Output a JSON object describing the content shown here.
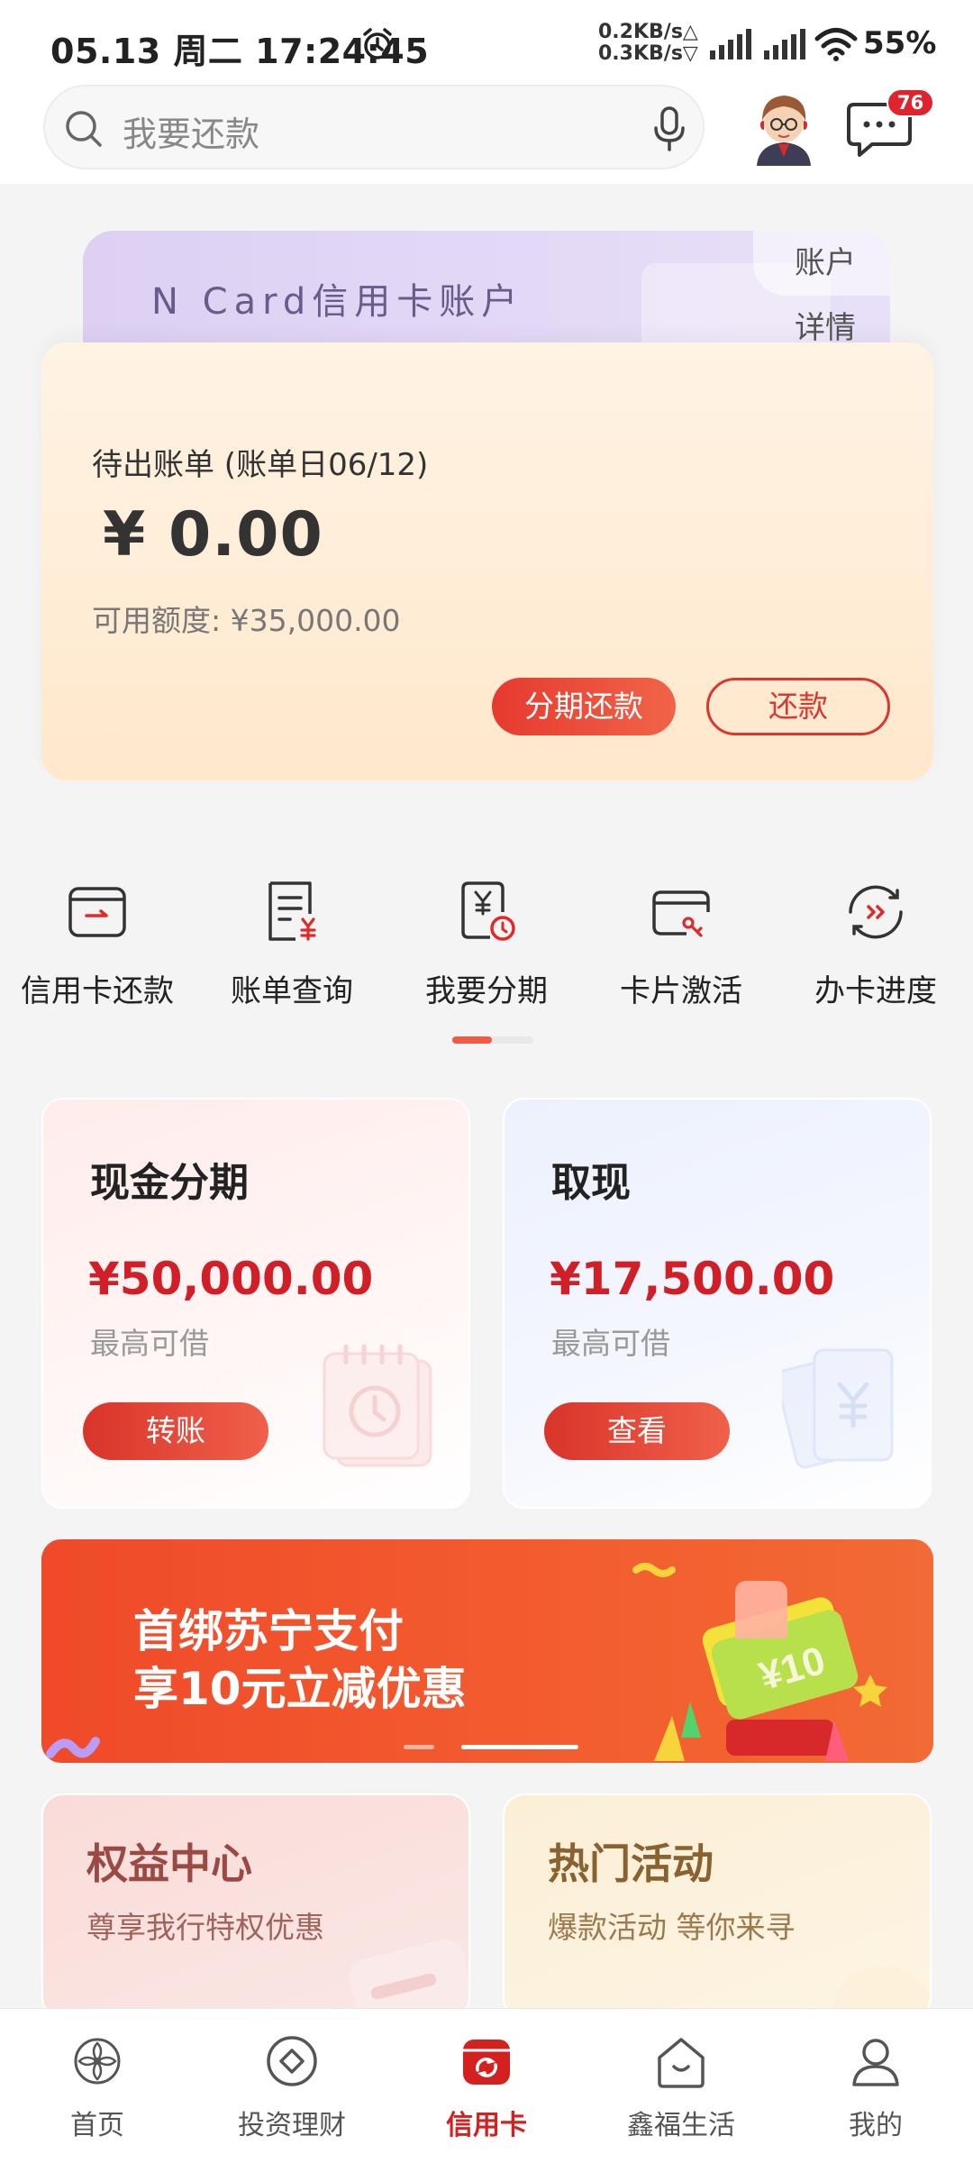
{
  "status_bar": {
    "time": "05.13 周二 17:24:45",
    "net_up": "0.2KB/s△",
    "net_down": "0.3KB/s▽",
    "battery": "55%",
    "icons": [
      "alarm-icon",
      "signal-icon",
      "signal-icon",
      "wifi-icon"
    ]
  },
  "header": {
    "search_placeholder": "我要还款",
    "message_badge": "76",
    "icons": [
      "search-icon",
      "mic-icon",
      "avatar",
      "message-icon"
    ]
  },
  "card_account": {
    "title": "N Card信用卡账户",
    "detail_link": "账户详情",
    "bill_label": "待出账单 (账单日06/12)",
    "bill_amount": "¥ 0.00",
    "available_credit": "可用额度: ¥35,000.00",
    "installment_button": "分期还款",
    "repay_button": "还款"
  },
  "quick_menu": [
    {
      "label": "信用卡还款",
      "icon": "card-repay-icon"
    },
    {
      "label": "账单查询",
      "icon": "bill-query-icon"
    },
    {
      "label": "我要分期",
      "icon": "installment-icon"
    },
    {
      "label": "卡片激活",
      "icon": "card-activate-icon"
    },
    {
      "label": "办卡进度",
      "icon": "card-progress-icon"
    }
  ],
  "loans": [
    {
      "title": "现金分期",
      "amount": "¥50,000.00",
      "sub": "最高可借",
      "button": "转账"
    },
    {
      "title": "取现",
      "amount": "¥17,500.00",
      "sub": "最高可借",
      "button": "查看"
    }
  ],
  "banner": {
    "line1": "首绑苏宁支付",
    "line2": "享10元立减优惠",
    "coupon_text": "¥10"
  },
  "promos": [
    {
      "title": "权益中心",
      "sub": "尊享我行特权优惠"
    },
    {
      "title": "热门活动",
      "sub": "爆款活动 等你来寻"
    }
  ],
  "tabbar": [
    {
      "label": "首页",
      "icon": "home-icon",
      "active": false
    },
    {
      "label": "投资理财",
      "icon": "invest-icon",
      "active": false
    },
    {
      "label": "信用卡",
      "icon": "credit-card-icon",
      "active": true
    },
    {
      "label": "鑫福生活",
      "icon": "life-icon",
      "active": false
    },
    {
      "label": "我的",
      "icon": "profile-icon",
      "active": false
    }
  ],
  "colors": {
    "accent": "#d3211f",
    "card_bg": "#ffe8cc",
    "banner_bg": "#ef4a2a"
  }
}
